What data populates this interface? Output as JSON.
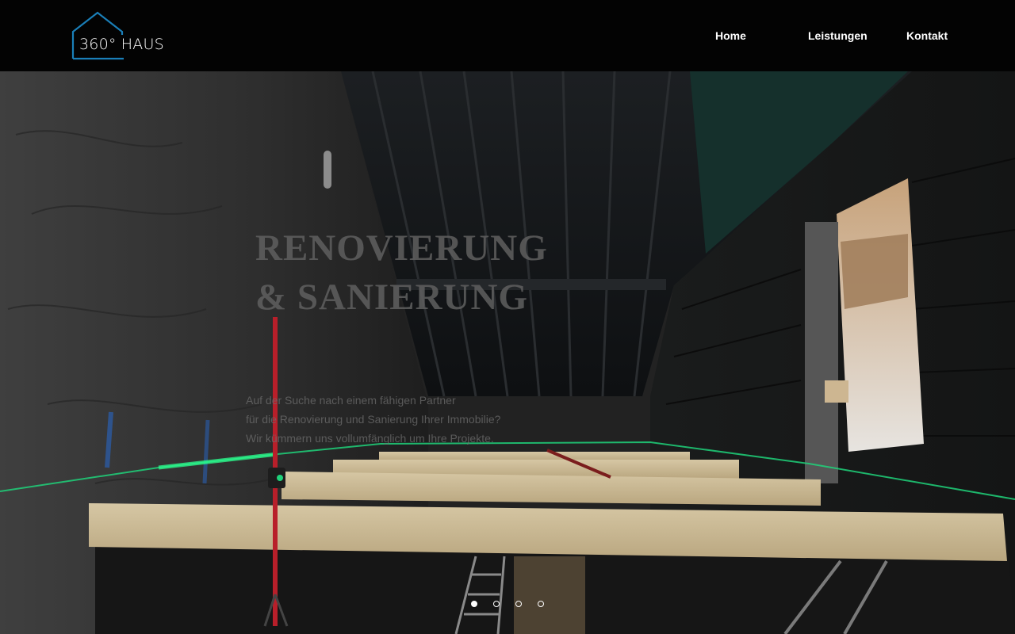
{
  "brand": {
    "logo_text": "360° HAUS",
    "logo_color": "#1a7fb8"
  },
  "nav": {
    "items": [
      {
        "label": "Home"
      },
      {
        "label": "Leistungen"
      },
      {
        "label": "Kontakt"
      }
    ]
  },
  "hero": {
    "title": "RENOVIERUNG & SANIERUNG",
    "subtitle_lines": [
      "Auf der Suche nach einem fähigen Partner",
      "für die Renovierung und Sanierung Ihrer Immobilie?",
      "Wir kümmern uns vollumfänglich um Ihre Projekte."
    ],
    "background_image": "attic-renovation-construction-photo"
  },
  "slider": {
    "slide_count": 4,
    "active_slide": 1
  },
  "colors": {
    "header_bg": "#030303",
    "nav_text": "#ffffff",
    "laser_green": "#1fd27a"
  }
}
